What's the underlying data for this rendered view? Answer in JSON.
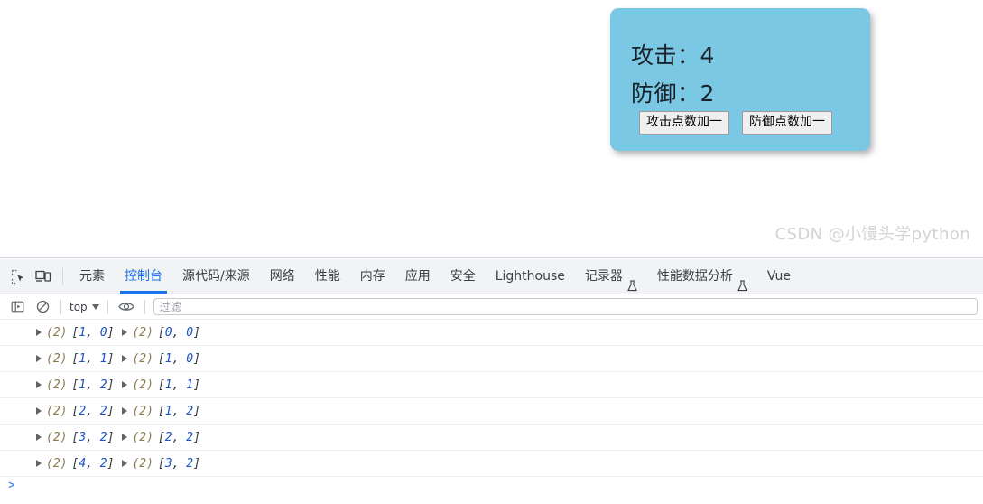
{
  "page": {
    "card": {
      "attack_label": "攻击：",
      "attack_value": "4",
      "defense_label": "防御：",
      "defense_value": "2",
      "attack_button": "攻击点数加一",
      "defense_button": "防御点数加一",
      "background_color": "#7ac8e3"
    },
    "watermark": "CSDN @小馒头学python"
  },
  "devtools": {
    "toolbar_icons": [
      {
        "name": "inspect-element-icon"
      },
      {
        "name": "device-toolbar-icon"
      }
    ],
    "tabs": [
      {
        "label": "元素",
        "active": false,
        "experimental": false
      },
      {
        "label": "控制台",
        "active": true,
        "experimental": false
      },
      {
        "label": "源代码/来源",
        "active": false,
        "experimental": false
      },
      {
        "label": "网络",
        "active": false,
        "experimental": false
      },
      {
        "label": "性能",
        "active": false,
        "experimental": false
      },
      {
        "label": "内存",
        "active": false,
        "experimental": false
      },
      {
        "label": "应用",
        "active": false,
        "experimental": false
      },
      {
        "label": "安全",
        "active": false,
        "experimental": false
      },
      {
        "label": "Lighthouse",
        "active": false,
        "experimental": false
      },
      {
        "label": "记录器",
        "active": false,
        "experimental": true
      },
      {
        "label": "性能数据分析",
        "active": false,
        "experimental": true
      },
      {
        "label": "Vue",
        "active": false,
        "experimental": false
      }
    ],
    "accent_color": "#1a73e8",
    "console_toolbar": {
      "sidebar_toggle": "console-sidebar-icon",
      "clear_console": "clear-console-icon",
      "context": "top",
      "live_expression": "eye-icon",
      "filter_placeholder": "过滤",
      "filter_value": ""
    },
    "console_messages": [
      {
        "first": {
          "count": "(2)",
          "open": "[",
          "a": "1",
          "comma": ", ",
          "b": "0",
          "close": "]"
        },
        "second": {
          "count": "(2)",
          "open": "[",
          "a": "0",
          "comma": ", ",
          "b": "0",
          "close": "]"
        }
      },
      {
        "first": {
          "count": "(2)",
          "open": "[",
          "a": "1",
          "comma": ", ",
          "b": "1",
          "close": "]"
        },
        "second": {
          "count": "(2)",
          "open": "[",
          "a": "1",
          "comma": ", ",
          "b": "0",
          "close": "]"
        }
      },
      {
        "first": {
          "count": "(2)",
          "open": "[",
          "a": "1",
          "comma": ", ",
          "b": "2",
          "close": "]"
        },
        "second": {
          "count": "(2)",
          "open": "[",
          "a": "1",
          "comma": ", ",
          "b": "1",
          "close": "]"
        }
      },
      {
        "first": {
          "count": "(2)",
          "open": "[",
          "a": "2",
          "comma": ", ",
          "b": "2",
          "close": "]"
        },
        "second": {
          "count": "(2)",
          "open": "[",
          "a": "1",
          "comma": ", ",
          "b": "2",
          "close": "]"
        }
      },
      {
        "first": {
          "count": "(2)",
          "open": "[",
          "a": "3",
          "comma": ", ",
          "b": "2",
          "close": "]"
        },
        "second": {
          "count": "(2)",
          "open": "[",
          "a": "2",
          "comma": ", ",
          "b": "2",
          "close": "]"
        }
      },
      {
        "first": {
          "count": "(2)",
          "open": "[",
          "a": "4",
          "comma": ", ",
          "b": "2",
          "close": "]"
        },
        "second": {
          "count": "(2)",
          "open": "[",
          "a": "3",
          "comma": ", ",
          "b": "2",
          "close": "]"
        }
      }
    ],
    "prompt_symbol": ">"
  }
}
